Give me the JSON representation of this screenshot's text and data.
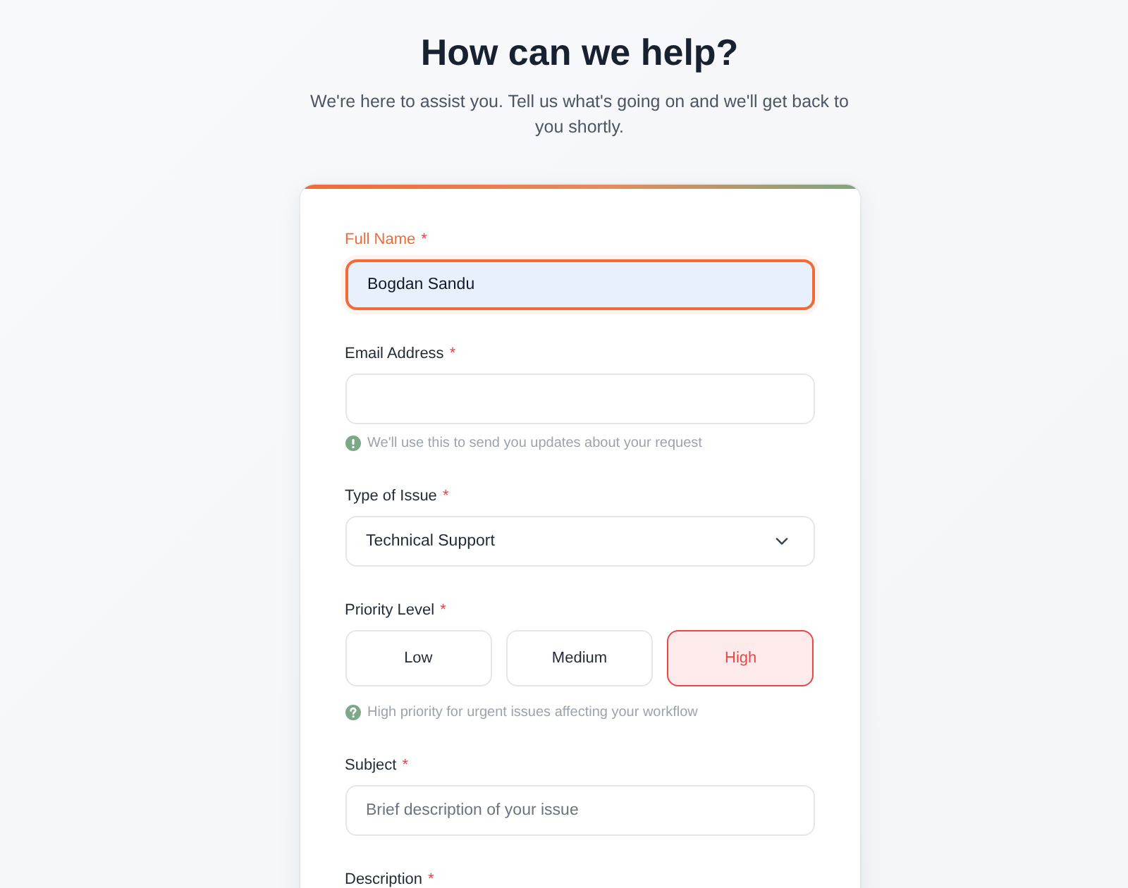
{
  "header": {
    "title": "How can we help?",
    "subtitle": "We're here to assist you. Tell us what's going on and we'll get back to you shortly."
  },
  "form": {
    "fields": [
      {
        "kind": "text",
        "label": "Full Name",
        "required_mark": "*",
        "focused": true,
        "value": "Bogdan Sandu"
      },
      {
        "kind": "text",
        "label": "Email Address",
        "required_mark": "*",
        "focused": false,
        "hint": {
          "kind": "info",
          "text": "We'll use this to send you updates about your request"
        }
      },
      {
        "kind": "select",
        "label": "Type of Issue",
        "required_mark": "*",
        "focused": false,
        "value": "Technical Support"
      },
      {
        "kind": "choice",
        "label": "Priority Level",
        "required_mark": "*",
        "focused": false,
        "options": [
          {
            "label": "Low",
            "selected": false
          },
          {
            "label": "Medium",
            "selected": false
          },
          {
            "label": "High",
            "selected": true
          }
        ],
        "hint": {
          "kind": "help",
          "text": "High priority for urgent issues affecting your workflow"
        }
      },
      {
        "kind": "text",
        "label": "Subject",
        "required_mark": "*",
        "focused": false,
        "placeholder": "Brief description of your issue"
      },
      {
        "kind": "label_only",
        "label": "Description",
        "required_mark": "*",
        "focused": false
      }
    ]
  }
}
